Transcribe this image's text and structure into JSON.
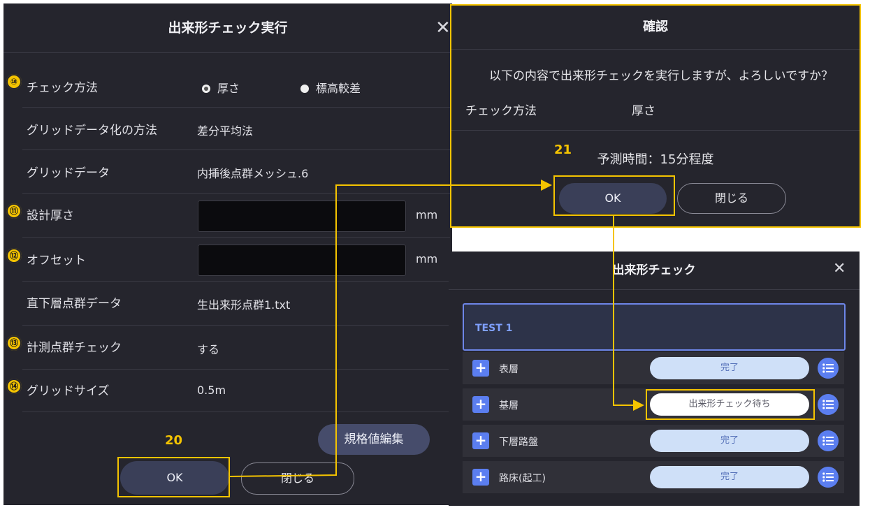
{
  "exec_dialog": {
    "title": "出来形チェック実行",
    "close_icon": "✕",
    "rows": {
      "check_method": {
        "marker": "⑩",
        "label": "チェック方法",
        "options": [
          "厚さ",
          "標高較差"
        ],
        "selected": "厚さ"
      },
      "grid_method": {
        "label": "グリッドデータ化の方法",
        "value": "差分平均法"
      },
      "grid_data": {
        "label": "グリッドデータ",
        "value": "内挿後点群メッシュ.6"
      },
      "design_thickness": {
        "marker": "⑪",
        "label": "設計厚さ",
        "value": "",
        "unit": "mm"
      },
      "offset": {
        "marker": "⑫",
        "label": "オフセット",
        "value": "",
        "unit": "mm"
      },
      "lower_pointcloud": {
        "label": "直下層点群データ",
        "value": "生出来形点群1.txt"
      },
      "measure_check": {
        "marker": "⑬",
        "label": "計測点群チェック",
        "value": "する"
      },
      "grid_size": {
        "marker": "⑭",
        "label": "グリッドサイズ",
        "value": "0.5m"
      }
    },
    "spec_edit_button": "規格値編集",
    "ok_button": "OK",
    "close_button": "閉じる"
  },
  "confirm_dialog": {
    "title": "確認",
    "message": "以下の内容で出来形チェックを実行しますが、よろしいですか？",
    "method_label": "チェック方法",
    "method_value": "厚さ",
    "time_text": "予測時間：15分程度",
    "ok_button": "OK",
    "close_button": "閉じる"
  },
  "check_panel": {
    "title": "出来形チェック",
    "close_icon": "✕",
    "test_name": "TEST 1",
    "layers": [
      {
        "name": "表層",
        "status": "完了"
      },
      {
        "name": "基層",
        "status": "出来形チェック待ち"
      },
      {
        "name": "下層路盤",
        "status": "完了"
      },
      {
        "name": "路床(起工)",
        "status": "完了"
      }
    ],
    "plus_glyph": "+"
  },
  "annotations": {
    "step_20": "20",
    "step_21": "21",
    "highlight_color": "#f5c400"
  }
}
